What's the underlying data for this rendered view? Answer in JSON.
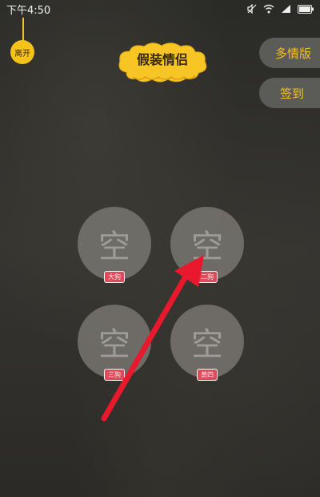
{
  "status_bar": {
    "time": "下午4:50",
    "icons": [
      "mute-icon",
      "wifi-icon",
      "signal-icon",
      "battery-icon"
    ]
  },
  "leave_button": {
    "label": "离开"
  },
  "title": {
    "label": "假装情侣"
  },
  "side_buttons": {
    "multi_version": "多情版",
    "sign_in": "签到"
  },
  "seats": [
    {
      "char": "空",
      "tag": "大狗"
    },
    {
      "char": "空",
      "tag": "二狗"
    },
    {
      "char": "空",
      "tag": "三狗"
    },
    {
      "char": "空",
      "tag": "黄四"
    }
  ],
  "colors": {
    "accent": "#f5c21a",
    "tag": "#e04a5a",
    "arrow": "#e8192c"
  }
}
